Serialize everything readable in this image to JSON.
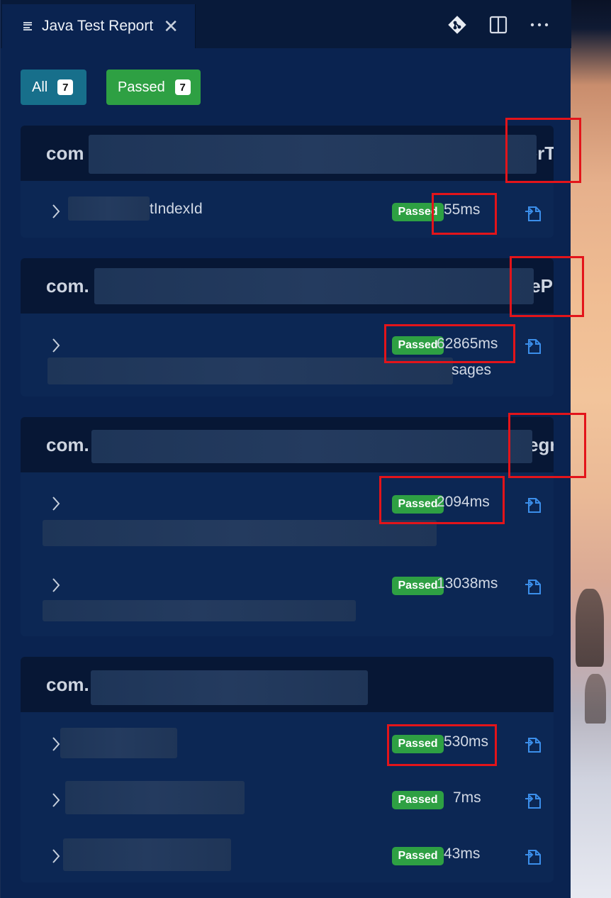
{
  "tab": {
    "title": "Java Test Report",
    "close_glyph": "✕"
  },
  "actions": {
    "git": "git-icon",
    "split": "split-editor-icon",
    "more": "···"
  },
  "filters": [
    {
      "label": "All",
      "count": "7",
      "color": "#176f8b"
    },
    {
      "label": "Passed",
      "count": "7",
      "color": "#2ea043"
    }
  ],
  "status_label": "Passed",
  "groups": [
    {
      "prefix": "com",
      "tail": "terTe",
      "tests": [
        {
          "name": "tIndexId",
          "duration": "55ms",
          "extra": ""
        }
      ]
    },
    {
      "prefix": "com.",
      "tail": "jePro",
      "tests": [
        {
          "name": "",
          "duration": "62865ms",
          "extra": "sages"
        }
      ]
    },
    {
      "prefix": "com.",
      "tail": "egra",
      "tests": [
        {
          "name": "",
          "duration": "2094ms",
          "extra": ""
        },
        {
          "name": "",
          "duration": "13038ms",
          "extra": ""
        }
      ]
    },
    {
      "prefix": "com.",
      "tail": "",
      "tests": [
        {
          "name": "",
          "duration": "530ms",
          "extra": ""
        },
        {
          "name": "",
          "duration": "7ms",
          "extra": ""
        },
        {
          "name": "",
          "duration": "43ms",
          "extra": ""
        }
      ]
    }
  ],
  "colors": {
    "highlight": "#e3141a",
    "passed": "#2ea043",
    "link": "#3b8eea"
  }
}
